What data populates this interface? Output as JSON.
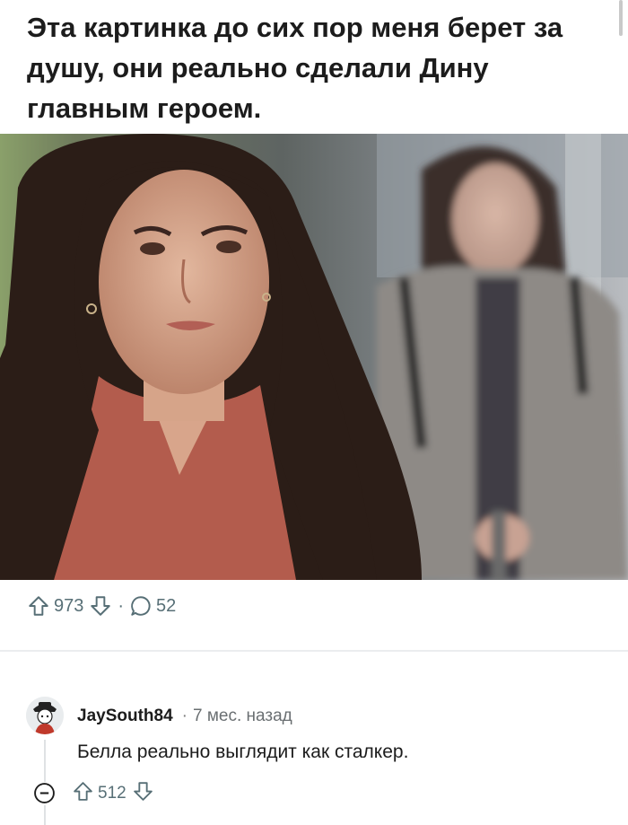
{
  "post": {
    "title": "Эта картинка до сих пор меня берет за душу, они реально сделали Дину главным героем.",
    "upvote_icon": "arrow-up-outline-icon",
    "downvote_icon": "arrow-down-outline-icon",
    "comment_icon": "speech-bubble-icon",
    "score": "973",
    "separator": "·",
    "comments_count": "52"
  },
  "comment": {
    "avatar_icon": "avatar-character-icon",
    "author": "JaySouth84",
    "separator": "·",
    "time": "7 мес. назад",
    "text": "Белла реально выглядит как сталкер.",
    "score": "512",
    "collapse_icon": "minus-circle-icon"
  },
  "colors": {
    "action_gray": "#576f76",
    "title_text": "#1c1c1c",
    "divider": "#ebedef"
  }
}
